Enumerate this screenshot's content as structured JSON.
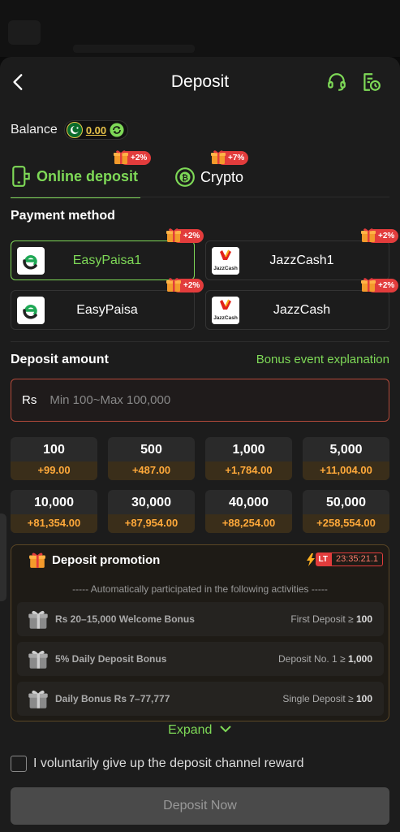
{
  "header": {
    "title": "Deposit"
  },
  "balance": {
    "label": "Balance",
    "value": "0.00"
  },
  "tabs": [
    {
      "label": "Online deposit",
      "badge": "+2%"
    },
    {
      "label": "Crypto",
      "badge": "+7%"
    }
  ],
  "payment": {
    "title": "Payment method",
    "methods": [
      {
        "name": "EasyPaisa1",
        "badge": "+2%",
        "logo": "easypaisa-logo"
      },
      {
        "name": "JazzCash1",
        "badge": "+2%",
        "logo": "jazzcash-logo"
      },
      {
        "name": "EasyPaisa",
        "badge": "+2%",
        "logo": "easypaisa-logo"
      },
      {
        "name": "JazzCash",
        "badge": "+2%",
        "logo": "jazzcash-logo"
      }
    ],
    "jazz_logo_text": "JazzCash"
  },
  "amount": {
    "title": "Deposit amount",
    "bonus_link": "Bonus event explanation",
    "currency": "Rs",
    "placeholder": "Min 100~Max 100,000",
    "chips": [
      {
        "amount": "100",
        "bonus": "+99.00"
      },
      {
        "amount": "500",
        "bonus": "+487.00"
      },
      {
        "amount": "1,000",
        "bonus": "+1,784.00"
      },
      {
        "amount": "5,000",
        "bonus": "+11,004.00"
      },
      {
        "amount": "10,000",
        "bonus": "+81,354.00"
      },
      {
        "amount": "30,000",
        "bonus": "+87,954.00"
      },
      {
        "amount": "40,000",
        "bonus": "+88,254.00"
      },
      {
        "amount": "50,000",
        "bonus": "+258,554.00"
      }
    ]
  },
  "promotion": {
    "title": "Deposit promotion",
    "timer_tag": "LT",
    "timer": "23:35:21.1",
    "note": "----- Automatically participated in the following activities -----",
    "activities": [
      {
        "name": "Rs 20–15,000 Welcome Bonus",
        "cond_prefix": "First Deposit ≥",
        "cond_value": "100"
      },
      {
        "name": "5% Daily Deposit Bonus",
        "cond_prefix": "Deposit No. 1 ≥",
        "cond_value": "1,000"
      },
      {
        "name": "Daily Bonus Rs 7–77,777",
        "cond_prefix": "Single Deposit ≥",
        "cond_value": "100"
      }
    ],
    "expand_label": "Expand"
  },
  "agreement": {
    "label": "I voluntarily give up the deposit channel reward"
  },
  "submit": {
    "label": "Deposit Now"
  },
  "colors": {
    "accent": "#7ed957",
    "badge": "#e23c3c",
    "bonus": "#ffa93a",
    "balance": "#e8c34a"
  }
}
